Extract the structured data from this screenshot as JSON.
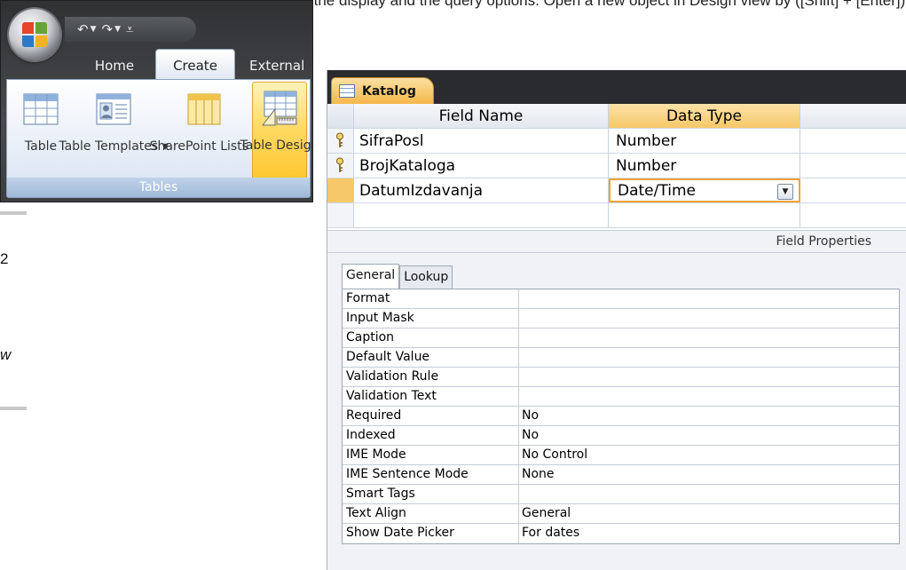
{
  "caption": "ng the display and the query options. Open a new object in Design view by ([Shift] + [Enter]).",
  "quick_access": {
    "undo": "↶",
    "redo": "↷",
    "customize": "⩡"
  },
  "ribbon": {
    "tabs": [
      "Home",
      "Create",
      "External"
    ],
    "buttons": [
      {
        "label": "Table",
        "icon": "table-icon"
      },
      {
        "label": "Table Templates ▾",
        "icon": "table-templates-icon"
      },
      {
        "label": "SharePoint Lists ▾",
        "icon": "sharepoint-lists-icon"
      },
      {
        "label": "Table Design",
        "icon": "table-design-icon"
      }
    ],
    "group_label": "Tables"
  },
  "left_fragments": [
    "2",
    "w"
  ],
  "document_tab": "Katalog",
  "grid": {
    "headers": {
      "field_name": "Field Name",
      "data_type": "Data Type"
    },
    "rows": [
      {
        "field_name": "SifraPosl",
        "data_type": "Number",
        "key": true
      },
      {
        "field_name": "BrojKataloga",
        "data_type": "Number",
        "key": true
      },
      {
        "field_name": "DatumIzdavanja",
        "data_type": "Date/Time",
        "key": false,
        "current": true
      },
      {
        "field_name": "",
        "data_type": "",
        "key": false
      }
    ]
  },
  "field_properties_label": "Field Properties",
  "property_tabs": [
    "General",
    "Lookup"
  ],
  "properties": [
    {
      "name": "Format",
      "value": ""
    },
    {
      "name": "Input Mask",
      "value": ""
    },
    {
      "name": "Caption",
      "value": ""
    },
    {
      "name": "Default Value",
      "value": ""
    },
    {
      "name": "Validation Rule",
      "value": ""
    },
    {
      "name": "Validation Text",
      "value": ""
    },
    {
      "name": "Required",
      "value": "No"
    },
    {
      "name": "Indexed",
      "value": "No"
    },
    {
      "name": "IME Mode",
      "value": "No Control"
    },
    {
      "name": "IME Sentence Mode",
      "value": "None"
    },
    {
      "name": "Smart Tags",
      "value": ""
    },
    {
      "name": "Text Align",
      "value": "General"
    },
    {
      "name": "Show Date Picker",
      "value": "For dates"
    }
  ],
  "colors": {
    "accent": "#f7c869",
    "ribbon_dark": "#3b3d40",
    "grid_line": "#c9d2df"
  }
}
